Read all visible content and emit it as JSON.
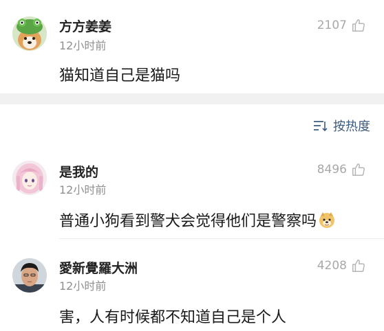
{
  "comments_top": [
    {
      "username": "方方姜姜",
      "time": "12小时前",
      "likes": "2107",
      "text": "猫知道自己是猫吗",
      "avatar_icon": "shiba-dog-frog-hat-icon"
    }
  ],
  "sort": {
    "label": "按热度",
    "icon": "sort-lines-icon"
  },
  "comments": [
    {
      "username": "是我的",
      "time": "12小时前",
      "likes": "8496",
      "text": "普通小狗看到警犬会觉得他们是警察吗",
      "emoji": "doge-face-icon",
      "avatar_icon": "anime-girl-avatar-icon"
    },
    {
      "username": "愛新覺羅大洲",
      "time": "12小时前",
      "likes": "4208",
      "text": "害，人有时候都不知道自己是个人",
      "avatar_icon": "man-portrait-avatar-icon"
    }
  ],
  "colors": {
    "username": "#222222",
    "meta": "#8f8f8f",
    "like": "#a8a8a8",
    "sort_accent": "#3c5a7d",
    "band": "#f1f1f1"
  }
}
